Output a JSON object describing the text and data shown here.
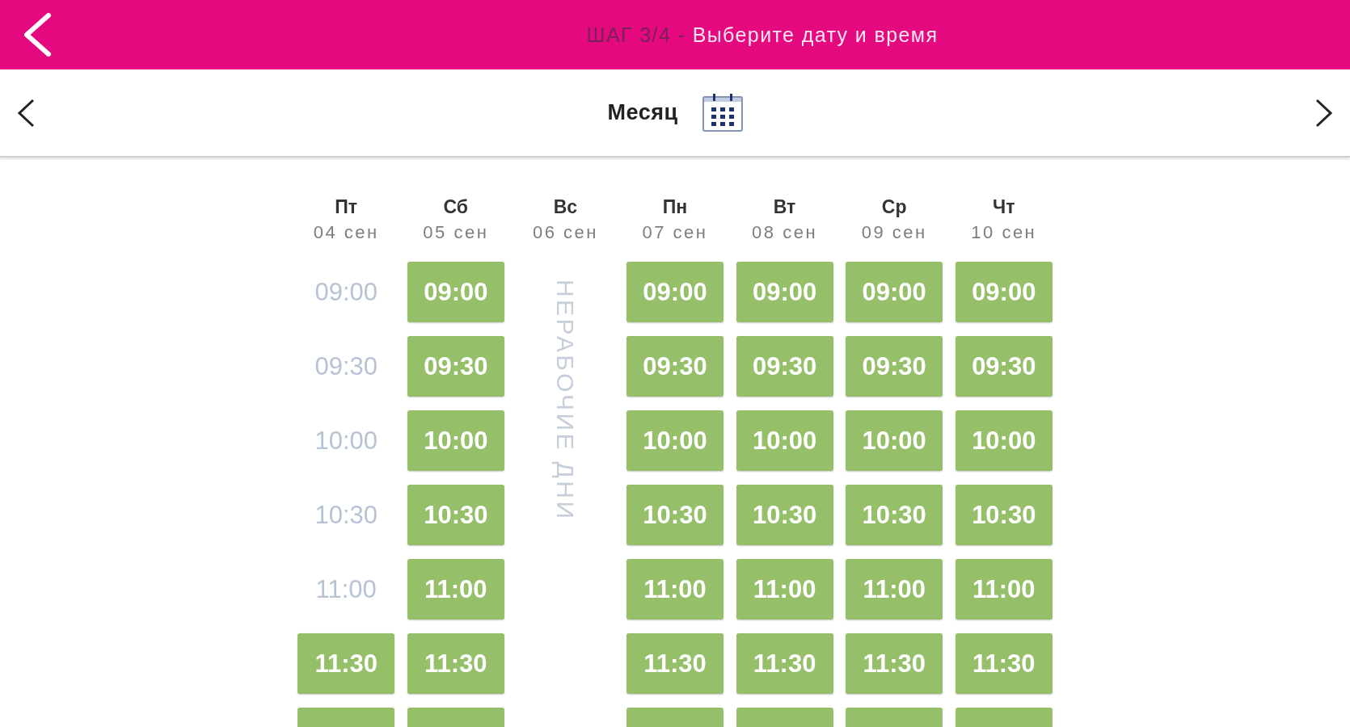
{
  "header": {
    "step": "ШАГ 3/4 -",
    "title": "Выберите дату и время"
  },
  "date_nav": {
    "period": "Месяц"
  },
  "days": [
    {
      "weekday": "Пт",
      "date": "04 сен",
      "kind": "workday",
      "slots": [
        {
          "time": "09:00",
          "available": false
        },
        {
          "time": "09:30",
          "available": false
        },
        {
          "time": "10:00",
          "available": false
        },
        {
          "time": "10:30",
          "available": false
        },
        {
          "time": "11:00",
          "available": false
        },
        {
          "time": "11:30",
          "available": true
        },
        {
          "available": true
        }
      ]
    },
    {
      "weekday": "Сб",
      "date": "05 сен",
      "kind": "workday",
      "slots": [
        {
          "time": "09:00",
          "available": true
        },
        {
          "time": "09:30",
          "available": true
        },
        {
          "time": "10:00",
          "available": true
        },
        {
          "time": "10:30",
          "available": true
        },
        {
          "time": "11:00",
          "available": true
        },
        {
          "time": "11:30",
          "available": true
        },
        {
          "available": true
        }
      ]
    },
    {
      "weekday": "Вс",
      "date": "06 сен",
      "kind": "dayoff",
      "note": "НЕРАБОЧИЕ ДНИ"
    },
    {
      "weekday": "Пн",
      "date": "07 сен",
      "kind": "workday",
      "slots": [
        {
          "time": "09:00",
          "available": true
        },
        {
          "time": "09:30",
          "available": true
        },
        {
          "time": "10:00",
          "available": true
        },
        {
          "time": "10:30",
          "available": true
        },
        {
          "time": "11:00",
          "available": true
        },
        {
          "time": "11:30",
          "available": true
        },
        {
          "available": true
        }
      ]
    },
    {
      "weekday": "Вт",
      "date": "08 сен",
      "kind": "workday",
      "slots": [
        {
          "time": "09:00",
          "available": true
        },
        {
          "time": "09:30",
          "available": true
        },
        {
          "time": "10:00",
          "available": true
        },
        {
          "time": "10:30",
          "available": true
        },
        {
          "time": "11:00",
          "available": true
        },
        {
          "time": "11:30",
          "available": true
        },
        {
          "available": true
        }
      ]
    },
    {
      "weekday": "Ср",
      "date": "09 сен",
      "kind": "workday",
      "slots": [
        {
          "time": "09:00",
          "available": true
        },
        {
          "time": "09:30",
          "available": true
        },
        {
          "time": "10:00",
          "available": true
        },
        {
          "time": "10:30",
          "available": true
        },
        {
          "time": "11:00",
          "available": true
        },
        {
          "time": "11:30",
          "available": true
        },
        {
          "available": true
        }
      ]
    },
    {
      "weekday": "Чт",
      "date": "10 сен",
      "kind": "workday",
      "slots": [
        {
          "time": "09:00",
          "available": true
        },
        {
          "time": "09:30",
          "available": true
        },
        {
          "time": "10:00",
          "available": true
        },
        {
          "time": "10:30",
          "available": true
        },
        {
          "time": "11:00",
          "available": true
        },
        {
          "time": "11:30",
          "available": true
        },
        {
          "available": true
        }
      ]
    }
  ]
}
